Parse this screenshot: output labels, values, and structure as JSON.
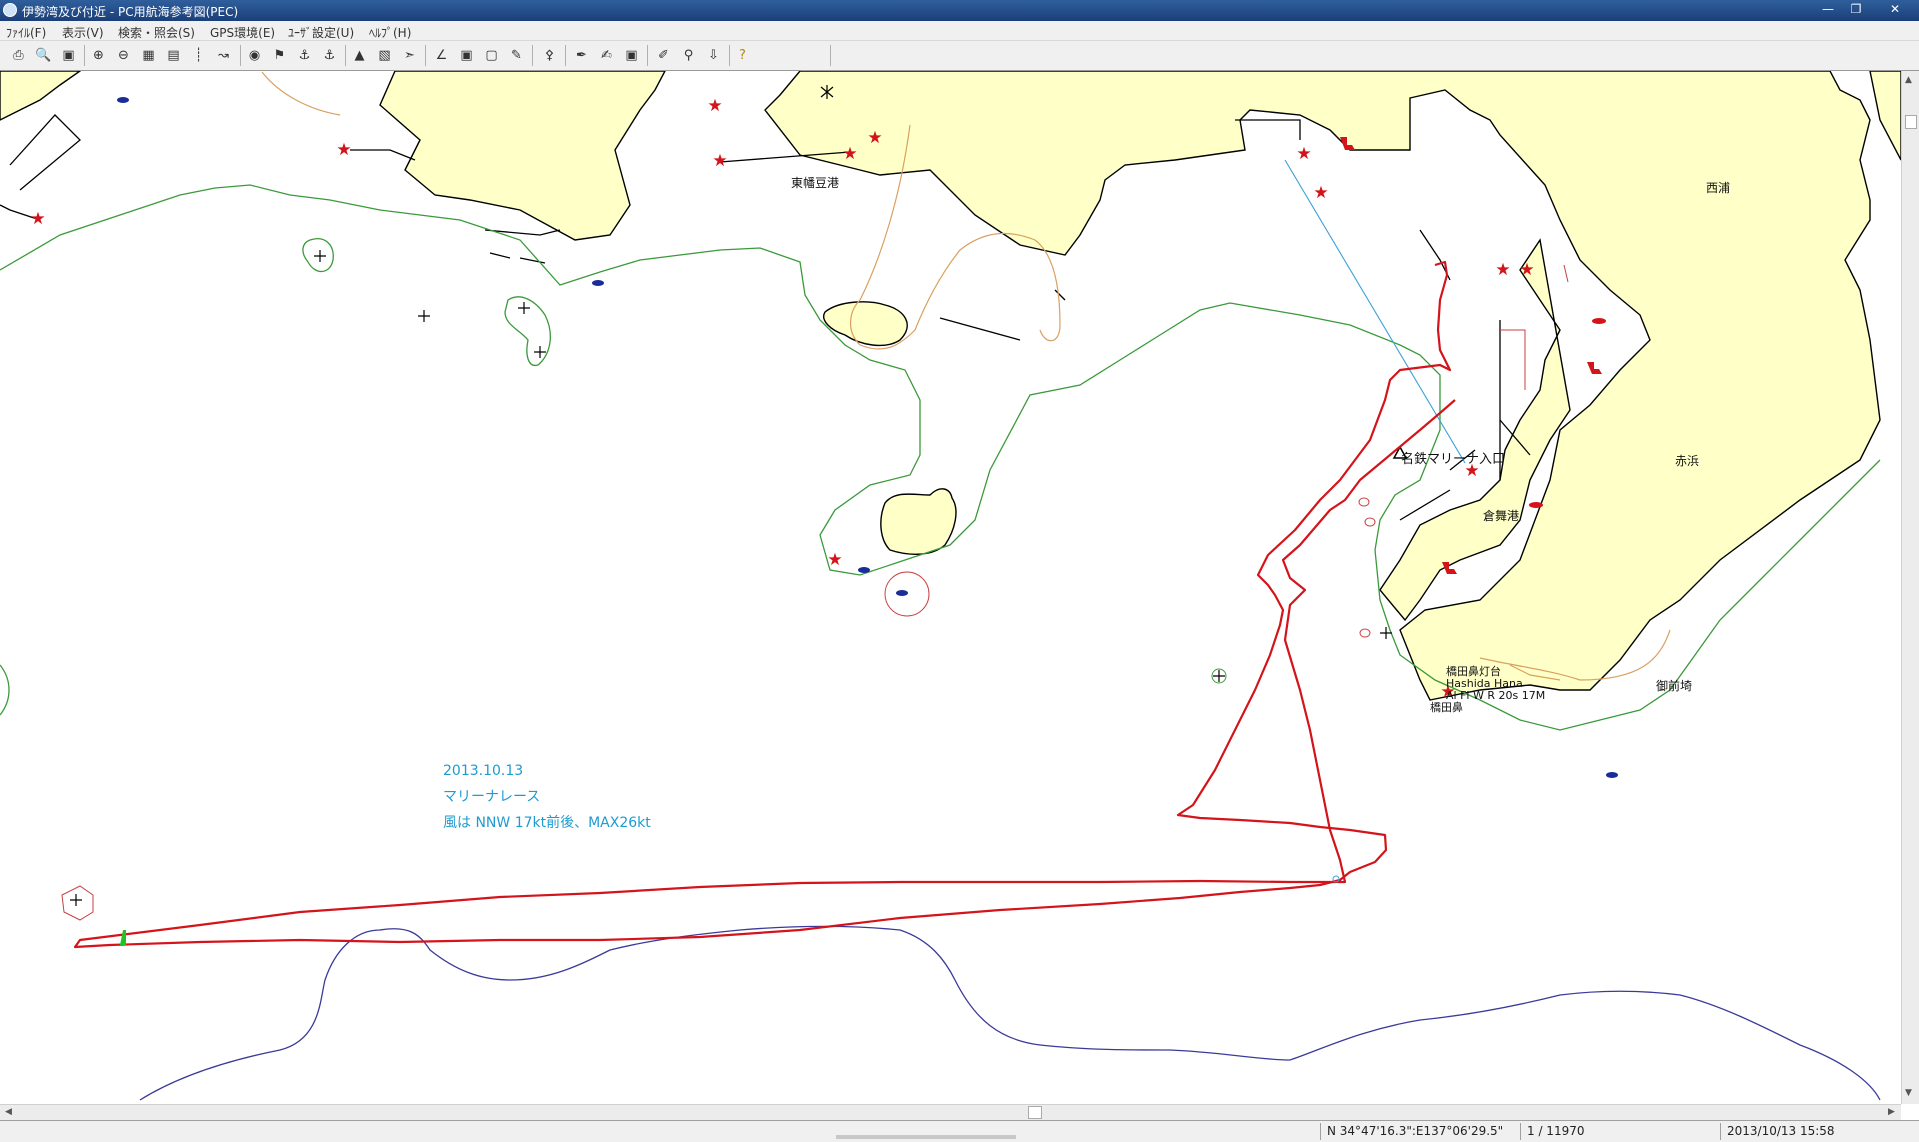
{
  "window": {
    "title": "伊勢湾及び付近 - PC用航海参考図(PEC)"
  },
  "menu": [
    {
      "id": "file",
      "label": "ﾌｧｲﾙ(F)"
    },
    {
      "id": "view",
      "label": "表示(V)"
    },
    {
      "id": "search",
      "label": "検索・照会(S)"
    },
    {
      "id": "gps",
      "label": "GPS環境(E)"
    },
    {
      "id": "user",
      "label": "ﾕｰｻﾞ設定(U)"
    },
    {
      "id": "help",
      "label": "ﾍﾙﾌﾟ(H)"
    }
  ],
  "map": {
    "places": {
      "higashi_hazu": "東幡豆港",
      "nishiura": "西浦",
      "akahama": "赤浜",
      "meitetsu": "名鉄マリーナ入口",
      "kurama": "倉舞港",
      "hashidabana_lighthouse": "橋田鼻灯台",
      "hashida_hana_en": "Hashida Hana",
      "light_char": "Al Fl W R 20s 17M",
      "hashidabana": "橋田鼻",
      "gozensaki": "御前埼"
    },
    "annotation": {
      "date": "2013.10.13",
      "event": "マリーナレース",
      "wind": "風は NNW 17kt前後、MAX26kt"
    },
    "colors": {
      "land": "#ffffc8",
      "track": "#d3141a",
      "contour_green": "#3a9a3a",
      "contour_orange": "#d9a060",
      "depth_blue": "#3a3a9a",
      "annotation": "#1e9bd1"
    }
  },
  "status": {
    "coordinates": "N 34°47'16.3\":E137°06'29.5\"",
    "scale": "1 / 11970",
    "datetime": "2013/10/13 15:58"
  }
}
